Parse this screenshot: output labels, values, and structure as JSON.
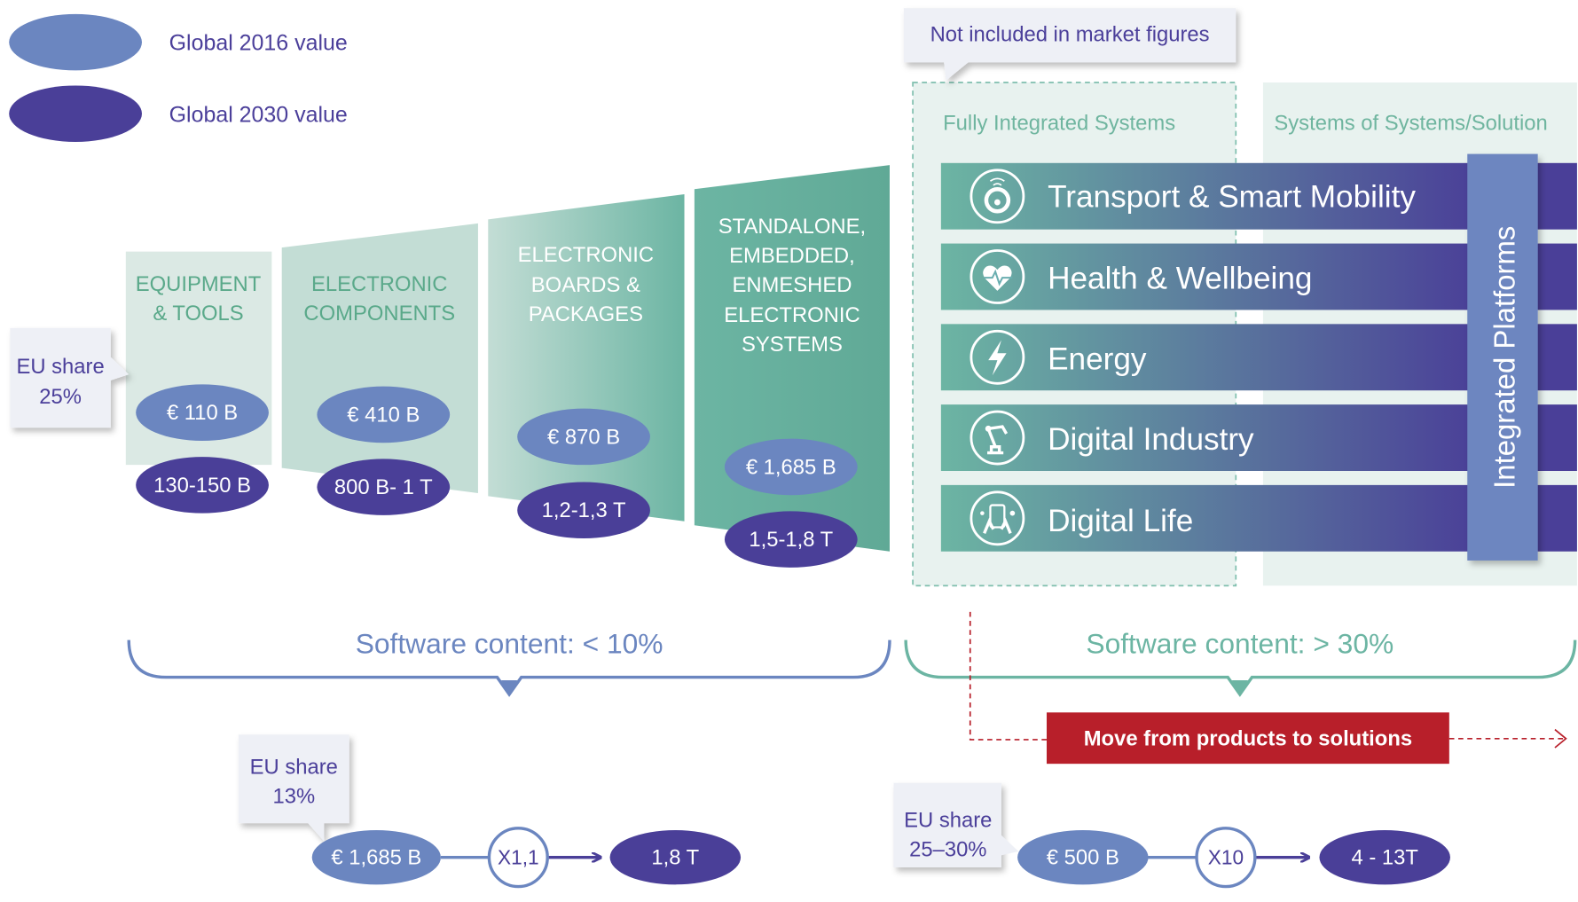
{
  "colors": {
    "value_2016": "#6b86c0",
    "value_2030": "#4a3f98",
    "teal": "#6cb5a3",
    "light_teal": "#dbe9e4",
    "label_green": "#5aa98a",
    "callout_bg": "#eef0f6",
    "red": "#b81f2a"
  },
  "legend": {
    "items": [
      {
        "label": "Global 2016 value"
      },
      {
        "label": "Global 2030 value"
      }
    ]
  },
  "eu_share_left": {
    "line1": "EU share",
    "line2": "25%"
  },
  "columns": [
    {
      "lines": [
        "EQUIPMENT",
        "& TOOLS"
      ],
      "value_2016": "€ 110 B",
      "value_2030": "130-150 B"
    },
    {
      "lines": [
        "ELECTRONIC",
        "COMPONENTS"
      ],
      "value_2016": "€ 410 B",
      "value_2030": "800 B- 1 T"
    },
    {
      "lines": [
        "ELECTRONIC",
        "BOARDS &",
        "PACKAGES"
      ],
      "value_2016": "€ 870 B",
      "value_2030": "1,2-1,3 T"
    },
    {
      "lines": [
        "STANDALONE,",
        "EMBEDDED,",
        "ENMESHED",
        "ELECTRONIC",
        "SYSTEMS"
      ],
      "value_2016": "€ 1,685 B",
      "value_2030": "1,5-1,8 T"
    }
  ],
  "not_included": "Not included in market figures",
  "fully_integrated_label": "Fully Integrated Systems",
  "systems_of_systems_label": "Systems of Systems/Solution",
  "integrated_platforms": "Integrated Platforms",
  "sectors": [
    {
      "label": "Transport & Smart Mobility",
      "icon": "steering-wheel-icon"
    },
    {
      "label": "Health & Wellbeing",
      "icon": "heart-pulse-icon"
    },
    {
      "label": "Energy",
      "icon": "lightning-icon"
    },
    {
      "label": "Digital Industry",
      "icon": "robot-arm-icon"
    },
    {
      "label": "Digital Life",
      "icon": "smartphone-hands-icon"
    }
  ],
  "software_left": "Software content: < 10%",
  "software_right": "Software content: > 30%",
  "move_label": "Move from products to solutions",
  "bottom_left": {
    "eu_line1": "EU share",
    "eu_line2": "13%",
    "from": "€ 1,685 B",
    "multiplier": "X1,1",
    "to": "1,8 T"
  },
  "bottom_right": {
    "eu_line1": "EU share",
    "eu_line2": "25–30%",
    "from": "€ 500 B",
    "multiplier": "X10",
    "to": "4 - 13T"
  }
}
